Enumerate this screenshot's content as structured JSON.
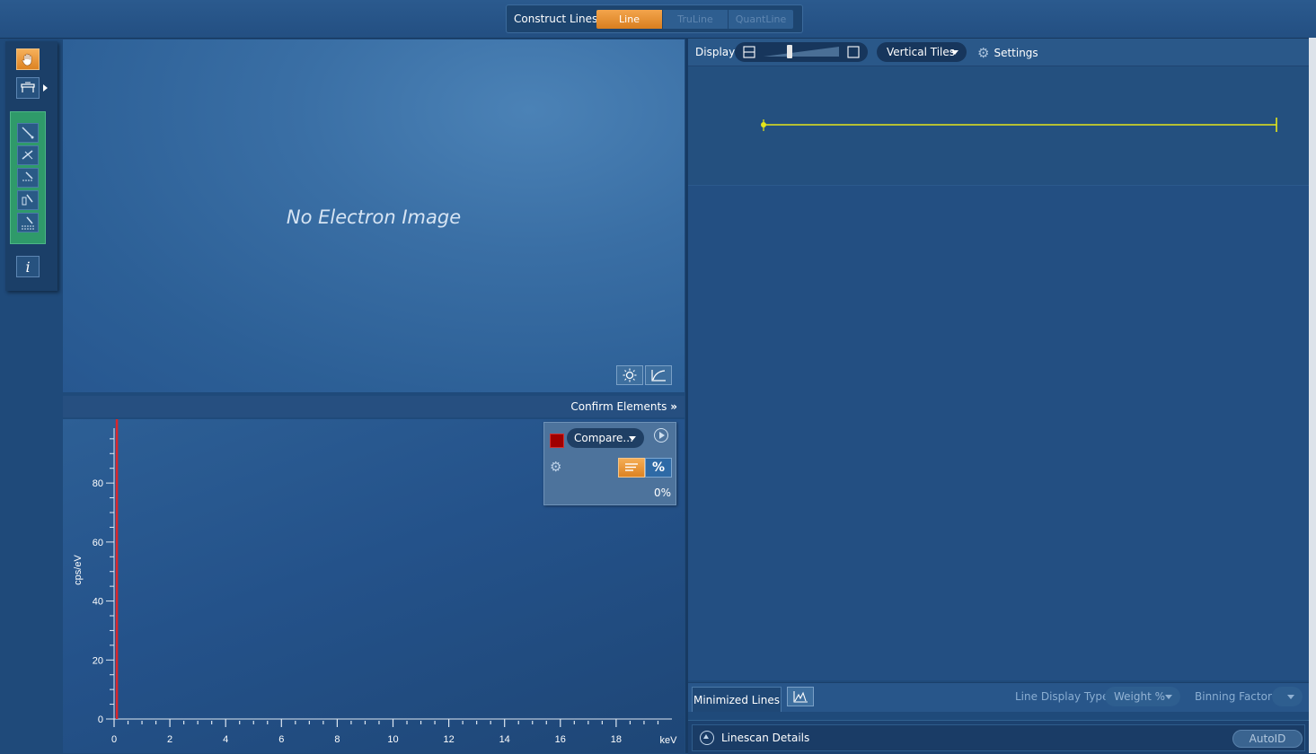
{
  "header": {
    "construct_label": "Construct Lines",
    "modes": [
      {
        "label": "Line",
        "active": true
      },
      {
        "label": "TruLine",
        "active": false
      },
      {
        "label": "QuantLine",
        "active": false
      }
    ],
    "accent_color": "#e8902f"
  },
  "toolbar": {
    "tools": [
      "hand-icon",
      "ruler-icon",
      "line-tool-icon",
      "line-tool-icon",
      "line-tool-icon",
      "line-tool-icon",
      "line-tool-icon",
      "info-icon"
    ],
    "info_glyph": "i"
  },
  "image_panel": {
    "placeholder": "No Electron Image",
    "buttons": [
      "brightness-icon",
      "curve-icon"
    ]
  },
  "confirm_elements": {
    "label": "Confirm Elements",
    "glyph": "»"
  },
  "spectrum": {
    "compare_label": "Compare...",
    "percent_button": "%",
    "percent_value": "0%",
    "swatch_color": "#a00000",
    "marker_color": "#d9262c"
  },
  "chart_data": {
    "type": "line",
    "xlabel": "keV",
    "ylabel": "cps/eV",
    "xlim": [
      0,
      20
    ],
    "ylim": [
      0,
      98
    ],
    "x_ticks": [
      0,
      2,
      4,
      6,
      8,
      10,
      12,
      14,
      16,
      18
    ],
    "y_ticks": [
      0,
      20,
      40,
      60,
      80
    ],
    "marker_x": 0.1,
    "series": []
  },
  "display_bar": {
    "label": "Display",
    "layout": "Vertical Tiles",
    "settings_label": "Settings"
  },
  "line_preview": {
    "color": "#e6e619"
  },
  "bottom_bar": {
    "tab_label": "Minimized Lines",
    "line_display_type_label": "Line Display Type:",
    "line_display_type_value": "Weight %",
    "binning_label": "Binning Factor:",
    "binning_value": ""
  },
  "details": {
    "label": "Linescan Details",
    "autoid_label": "AutoID"
  }
}
